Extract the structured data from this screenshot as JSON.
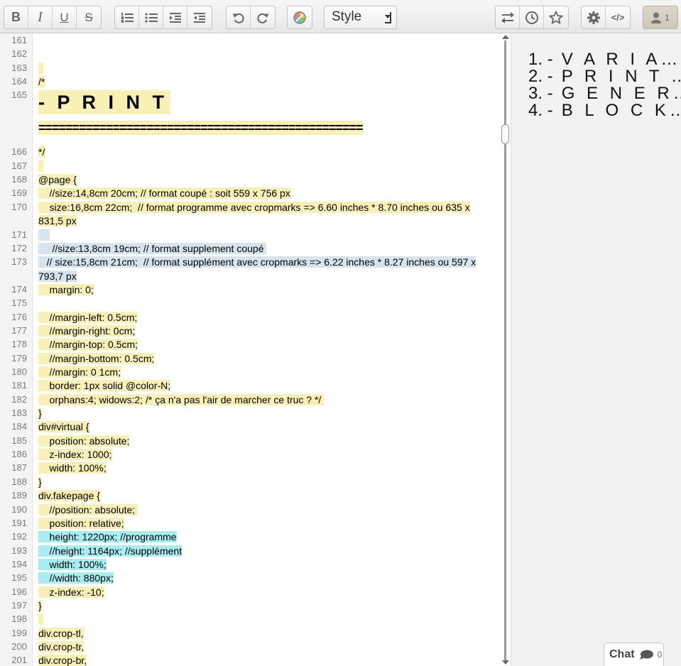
{
  "toolbar": {
    "style_label": "Style",
    "user_count": "1",
    "buttons": [
      "bold-icon",
      "italic-icon",
      "underline-icon",
      "strikethrough-icon",
      "ordered-list-icon",
      "unordered-list-icon",
      "indent-icon",
      "outdent-icon",
      "undo-icon",
      "redo-icon",
      "color-icon",
      "import-export-icon",
      "history-icon",
      "star-icon",
      "settings-icon",
      "embed-icon"
    ],
    "glyphs": {
      "bold": "B",
      "italic": "I",
      "underline": "U",
      "strike": "S",
      "embed": "</>"
    }
  },
  "editor": {
    "lines": [
      {
        "n": "161",
        "t": "",
        "c": ""
      },
      {
        "n": "162",
        "t": "",
        "c": ""
      },
      {
        "n": "163",
        "t": "",
        "c": "hl"
      },
      {
        "n": "164",
        "t": "/*",
        "c": "hl"
      },
      {
        "n": "165",
        "t": "- P R I N T",
        "c": "hl h1"
      },
      {
        "n": "",
        "t": "================================================",
        "c": "hl hr"
      },
      {
        "n": "166",
        "t": "*/",
        "c": "hl"
      },
      {
        "n": "167",
        "t": "",
        "c": "hl"
      },
      {
        "n": "168",
        "t": "@page {",
        "c": "hl"
      },
      {
        "n": "169",
        "t": "    //size:14,8cm 20cm; // format coupé : soit 559 x 756 px",
        "c": "hl"
      },
      {
        "n": "170",
        "t": "    size:16,8cm 22cm;  // format programme avec cropmarks => 6.60 inches * 8.70 inches ou 635 x",
        "c": "hl"
      },
      {
        "n": "",
        "t": "831,5 px",
        "c": "hl"
      },
      {
        "n": "171",
        "t": "    ",
        "c": "hl-blue"
      },
      {
        "n": "172",
        "t": "     //size:13,8cm 19cm; // format supplement coupé ",
        "c": "hl-blue"
      },
      {
        "n": "173",
        "t": "   // size:15,8cm 21cm;  // format supplément avec cropmarks => 6.22 inches * 8.27 inches ou 597 x",
        "c": "hl-blue"
      },
      {
        "n": "",
        "t": "793,7 px",
        "c": "hl-blue"
      },
      {
        "n": "174",
        "t": "    margin: 0;",
        "c": "hl"
      },
      {
        "n": "175",
        "t": "",
        "c": ""
      },
      {
        "n": "176",
        "t": "    //margin-left: 0.5cm;",
        "c": "hl"
      },
      {
        "n": "177",
        "t": "    //margin-right: 0cm;",
        "c": "hl"
      },
      {
        "n": "178",
        "t": "    //margin-top: 0.5cm;",
        "c": "hl"
      },
      {
        "n": "179",
        "t": "    //margin-bottom: 0.5cm;",
        "c": "hl"
      },
      {
        "n": "180",
        "t": "    //margin: 0 1cm;",
        "c": "hl"
      },
      {
        "n": "181",
        "t": "    border: 1px solid @color-N;",
        "c": "hl"
      },
      {
        "n": "182",
        "t": "    orphans:4; widows:2; /* ça n'a pas l'air de marcher ce truc ? */ ",
        "c": "hl"
      },
      {
        "n": "183",
        "t": "}",
        "c": "hl"
      },
      {
        "n": "184",
        "t": "div#virtual {",
        "c": "hl"
      },
      {
        "n": "185",
        "t": "    position: absolute;",
        "c": "hl"
      },
      {
        "n": "186",
        "t": "    z-index: 1000;",
        "c": "hl"
      },
      {
        "n": "187",
        "t": "    width: 100%;",
        "c": "hl"
      },
      {
        "n": "188",
        "t": "}",
        "c": "hl"
      },
      {
        "n": "189",
        "t": "div.fakepage {",
        "c": "hl"
      },
      {
        "n": "190",
        "t": "    //position: absolute; ",
        "c": "hl"
      },
      {
        "n": "191",
        "t": "    position: relative;",
        "c": "hl"
      },
      {
        "n": "192",
        "t": "    height: 1220px; //programme",
        "c": "hl-cyan"
      },
      {
        "n": "193",
        "t": "    //height: 1164px; //supplément",
        "c": "hl-cyan"
      },
      {
        "n": "194",
        "t": "    width: 100%;",
        "c": "hl-cyan"
      },
      {
        "n": "195",
        "t": "    //width: 880px;",
        "c": "hl-cyan"
      },
      {
        "n": "196",
        "t": "    z-index: -10;",
        "c": "hl"
      },
      {
        "n": "197",
        "t": "}",
        "c": "hl"
      },
      {
        "n": "198",
        "t": "",
        "c": "hl"
      },
      {
        "n": "199",
        "t": "div.crop-tl,",
        "c": "hl"
      },
      {
        "n": "200",
        "t": "div.crop-tr,",
        "c": "hl"
      },
      {
        "n": "201",
        "t": "div.crop-br,",
        "c": "hl"
      }
    ]
  },
  "toc": {
    "items": [
      {
        "num": "1. -",
        "label": "V A R I A…"
      },
      {
        "num": "2. -",
        "label": "P R I N T  …"
      },
      {
        "num": "3. -",
        "label": "G E N E R…"
      },
      {
        "num": "4. -",
        "label": "B L O C K…"
      }
    ]
  },
  "chat": {
    "label": "Chat",
    "count": "0"
  },
  "colors": {
    "author_yellow": "#f8f0b4",
    "author_blue": "#d6e4ee",
    "author_cyan": "#a6eef2"
  }
}
